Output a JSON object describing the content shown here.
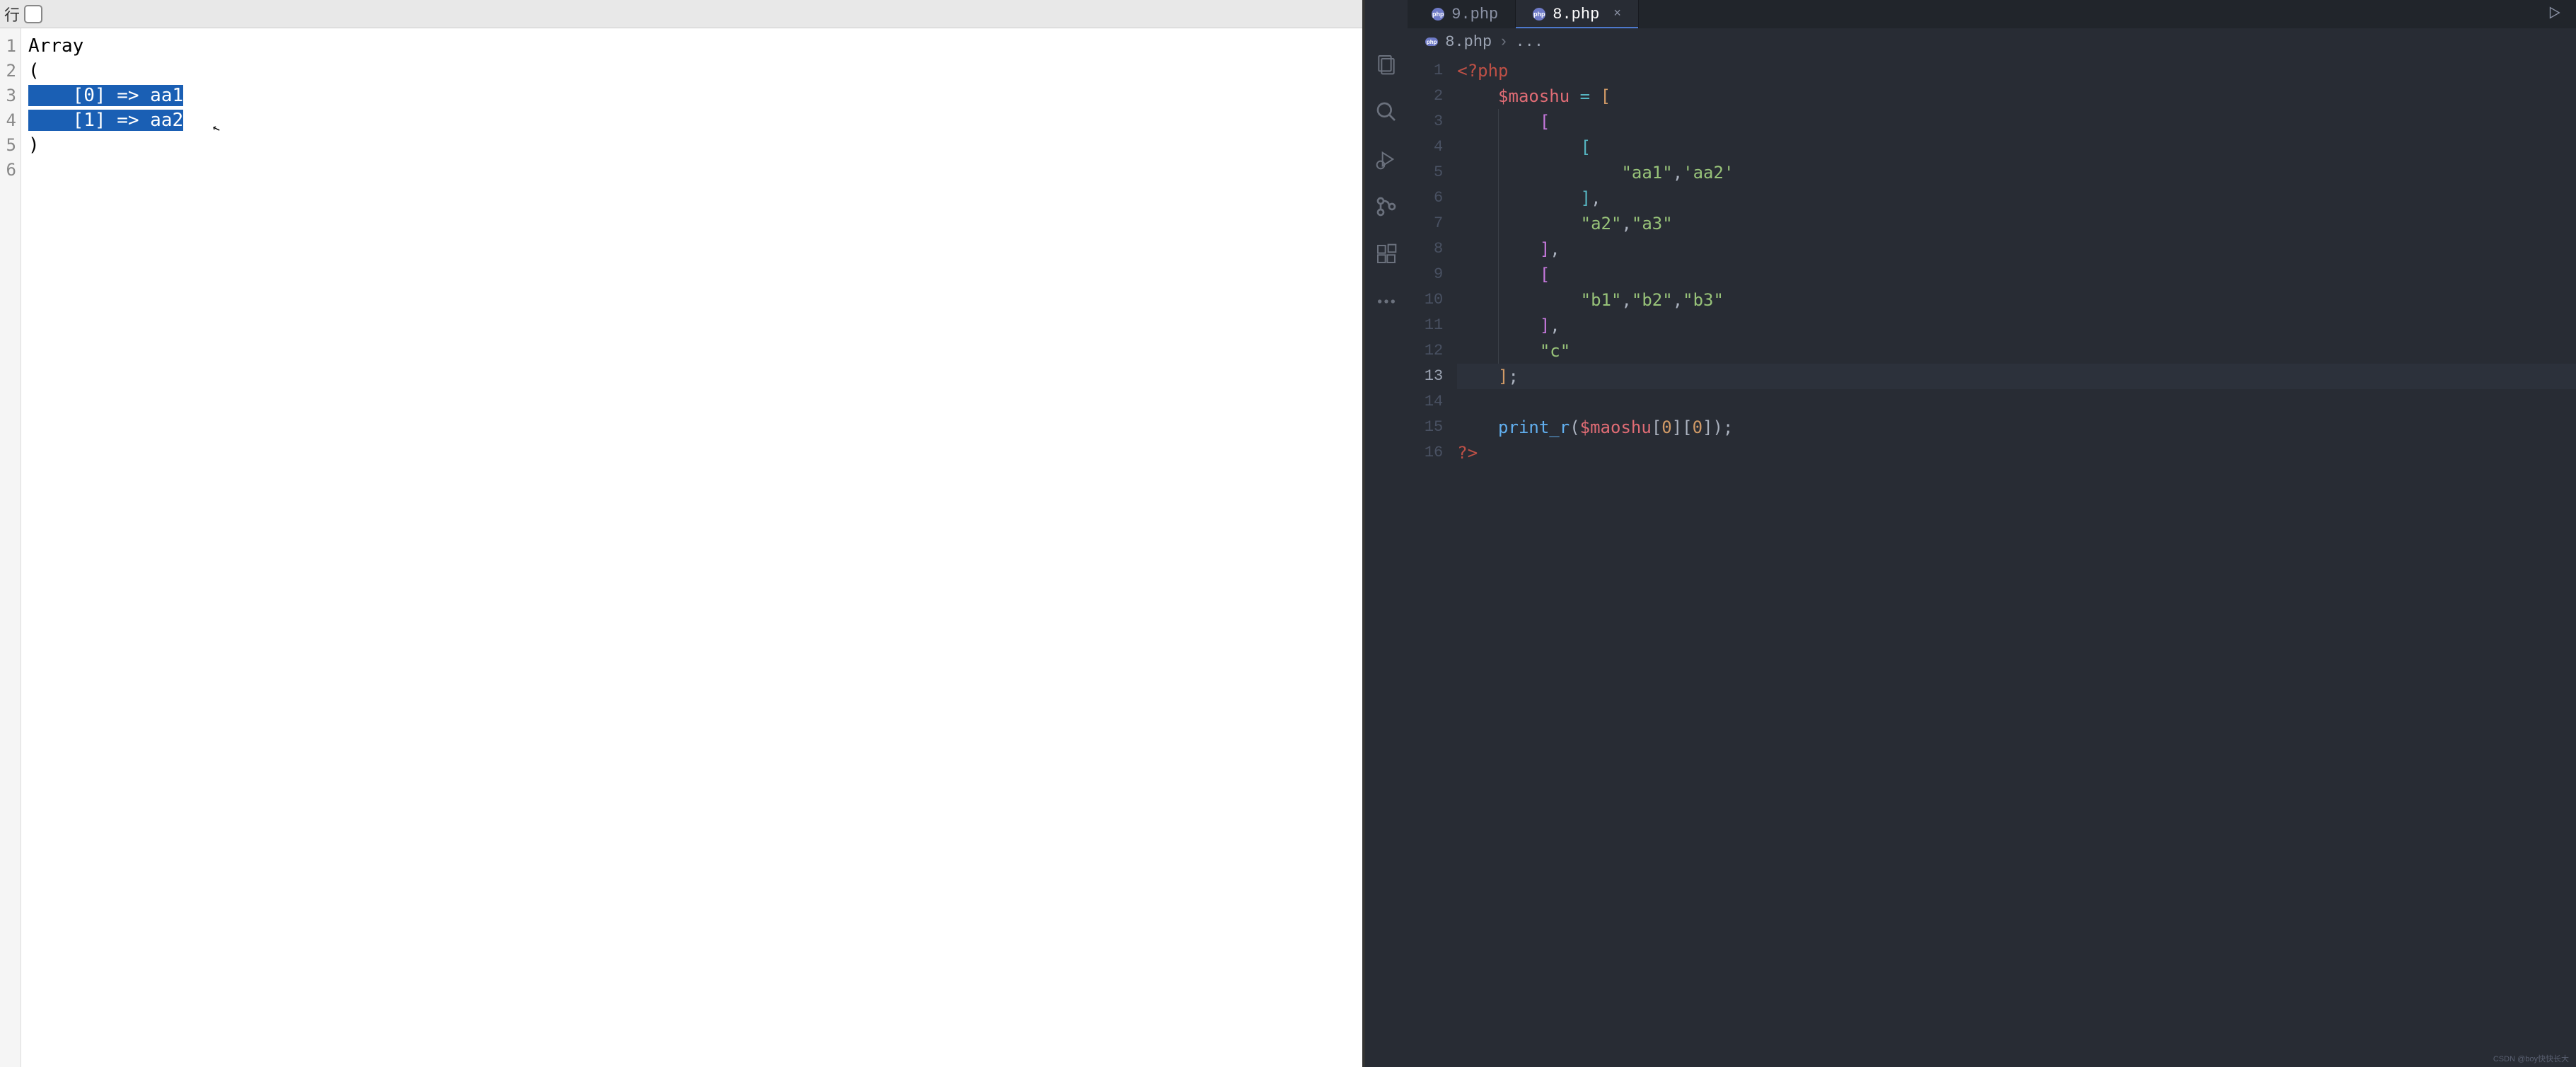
{
  "left": {
    "toolbar_label": "行",
    "gutter": [
      "1",
      "2",
      "3",
      "4",
      "5",
      "6"
    ],
    "lines": {
      "l1": "Array",
      "l2": "(",
      "l3_sel": "    [0] => aa1",
      "l4_sel": "    [1] => aa2",
      "l5": ")",
      "l6": ""
    }
  },
  "right": {
    "tabs": {
      "inactive": "9.php",
      "active": "8.php"
    },
    "breadcrumb": {
      "file": "8.php",
      "rest": "..."
    },
    "gutter": [
      "1",
      "2",
      "3",
      "4",
      "5",
      "6",
      "7",
      "8",
      "9",
      "10",
      "11",
      "12",
      "13",
      "14",
      "15",
      "16"
    ],
    "current_line": "13",
    "code": {
      "l1": {
        "tag": "<?php"
      },
      "l2": {
        "var": "$maoshu",
        "op": "=",
        "br": "["
      },
      "l3": {
        "br": "["
      },
      "l4": {
        "br": "["
      },
      "l5": {
        "s1": "\"aa1\"",
        "s2": "'aa2'"
      },
      "l6": {
        "br": "]",
        "comma": ","
      },
      "l7": {
        "s1": "\"a2\"",
        "s2": "\"a3\""
      },
      "l8": {
        "br": "]",
        "comma": ","
      },
      "l9": {
        "br": "["
      },
      "l10": {
        "s1": "\"b1\"",
        "s2": "\"b2\"",
        "s3": "\"b3\""
      },
      "l11": {
        "br": "]",
        "comma": ","
      },
      "l12": {
        "s1": "\"c\""
      },
      "l13": {
        "br": "]",
        "semi": ";"
      },
      "l14": {},
      "l15": {
        "func": "print_r",
        "var": "$maoshu",
        "n1": "0",
        "n2": "0"
      },
      "l16": {
        "tag": "?>"
      }
    }
  },
  "watermark": "CSDN @boy快快长大"
}
